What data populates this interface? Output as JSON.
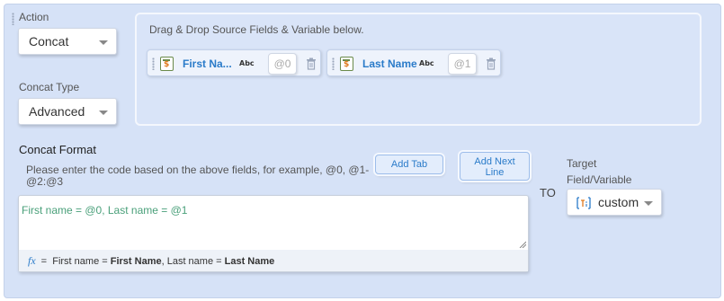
{
  "action": {
    "label": "Action",
    "value": "Concat"
  },
  "concat_type": {
    "label": "Concat Type",
    "value": "Advanced"
  },
  "drop_area": {
    "hint": "Drag & Drop Source Fields & Variable below.",
    "fields": [
      {
        "name": "First Na...",
        "type": "Abc",
        "index": "@0"
      },
      {
        "name": "Last Name",
        "type": "Abc",
        "index": "@1"
      }
    ]
  },
  "concat_format": {
    "label": "Concat Format",
    "help": "Please enter the code based on the above fields, for example, @0, @1-@2:@3",
    "help_line1": "Please enter the code based on the above fields, for example, @0, @1-",
    "help_line2": "@2:@3",
    "value": "First name = @0, Last name = @1",
    "add_tab": "Add Tab",
    "add_next_line_1": "Add Next",
    "add_next_line_2": "Line",
    "preview": {
      "fx": "fx",
      "eq": "=",
      "part1": "First name = ",
      "bold1": "First Name",
      "part2": ", Last name = ",
      "bold2": "Last Name"
    }
  },
  "to_label": "TO",
  "target": {
    "label_line1": "Target",
    "label_line2": "Field/Variable",
    "value": "custom"
  },
  "colors": {
    "panel": "#d6e2f7",
    "accent": "#2a7bc9",
    "formula_text": "#4aa07a"
  },
  "icons": [
    "drag-handle-icon",
    "field-icon",
    "trash-icon",
    "chevron-down-icon",
    "fx-icon",
    "variable-type-icon"
  ]
}
